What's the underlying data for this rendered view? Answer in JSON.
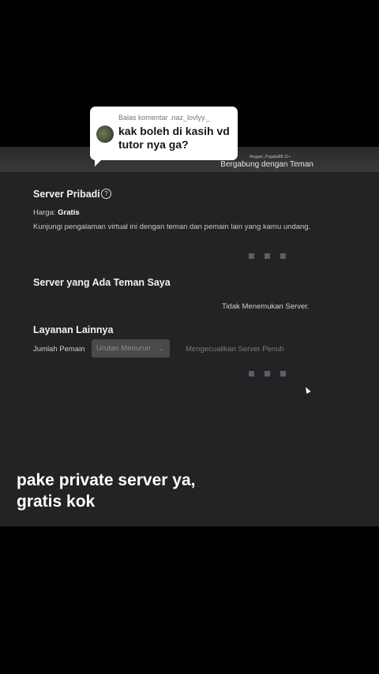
{
  "comment": {
    "reply_to": "Balas komentar .naz_lovlyy._",
    "text": "kak boleh di kasih vd tutor nya ga?"
  },
  "topbar": {
    "small_text": "Anggan_Pugatai88 11+",
    "join_friends": "Bergabung dengan Teman"
  },
  "private_server": {
    "title": "Server Pribadi",
    "help_icon": "?",
    "price_label": "Harga:",
    "price_value": "Gratis",
    "description": "Kunjungi pengalaman virtual ini dengan teman dan pemain lain yang kamu undang."
  },
  "friends_servers": {
    "title": "Server yang Ada Teman Saya",
    "empty": "Tidak Menemukan Server."
  },
  "other_servers": {
    "title": "Layanan Lainnya",
    "sort_label": "Jumlah Pemain",
    "sort_value": "Urutan Menurun",
    "exclude_full": "Mengecualikan Server Penuh"
  },
  "caption": {
    "line1": "pake private server ya,",
    "line2": "gratis kok"
  },
  "icons": {
    "help": "question-circle-icon",
    "dropdown": "chevron-down-icon",
    "cursor": "mouse-cursor-icon"
  }
}
